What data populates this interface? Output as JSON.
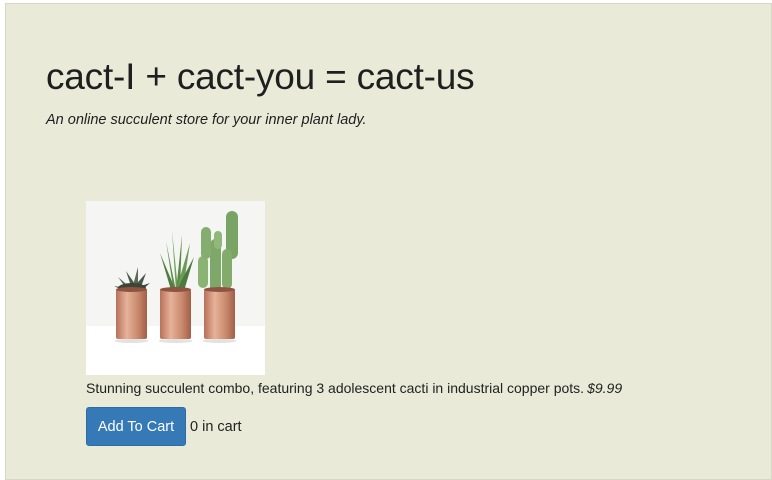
{
  "header": {
    "title": "cact-I + cact-you = cact-us",
    "subtitle": "An online succulent store for your inner plant lady."
  },
  "product": {
    "image_alt": "Three succulents in copper pots",
    "description": "Stunning succulent combo, featuring 3 adolescent cacti in industrial copper pots.",
    "price": "$9.99"
  },
  "cart": {
    "add_label": "Add To Cart",
    "count_label": "0 in cart"
  },
  "colors": {
    "page_background": "#e9ebd8",
    "button_primary": "#357ab7",
    "pot_copper": "#c98a6e"
  }
}
